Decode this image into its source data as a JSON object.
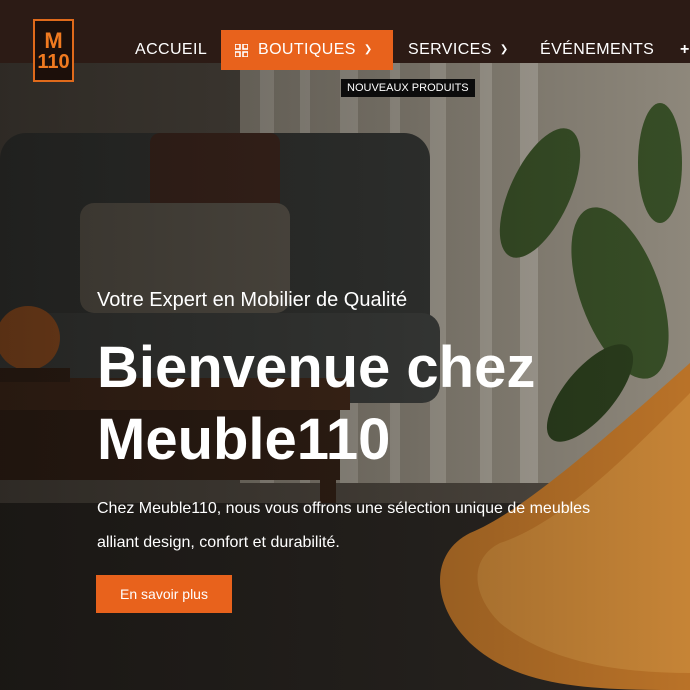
{
  "logo": {
    "text_top": "M",
    "text_bottom": "110"
  },
  "nav": {
    "items": [
      {
        "label": "ACCUEIL"
      },
      {
        "label": "BOUTIQUES",
        "icon": "grid-icon",
        "active": true
      },
      {
        "label": "SERVICES"
      },
      {
        "label": "ÉVÉNEMENTS"
      },
      {
        "label": "+"
      }
    ],
    "badge": "NOUVEAUX PRODUITS",
    "accent": "#e8621c"
  },
  "hero": {
    "subtitle": "Votre Expert en Mobilier de Qualité",
    "title_line1": "Bienvenue chez",
    "title_line2": "Meuble110",
    "description": "Chez Meuble110, nous vous offrons une sélection unique de meubles alliant design, confort et durabilité.",
    "cta": "En savoir plus"
  },
  "colors": {
    "topbar": "#2c1b15",
    "button": "#e8621c"
  }
}
